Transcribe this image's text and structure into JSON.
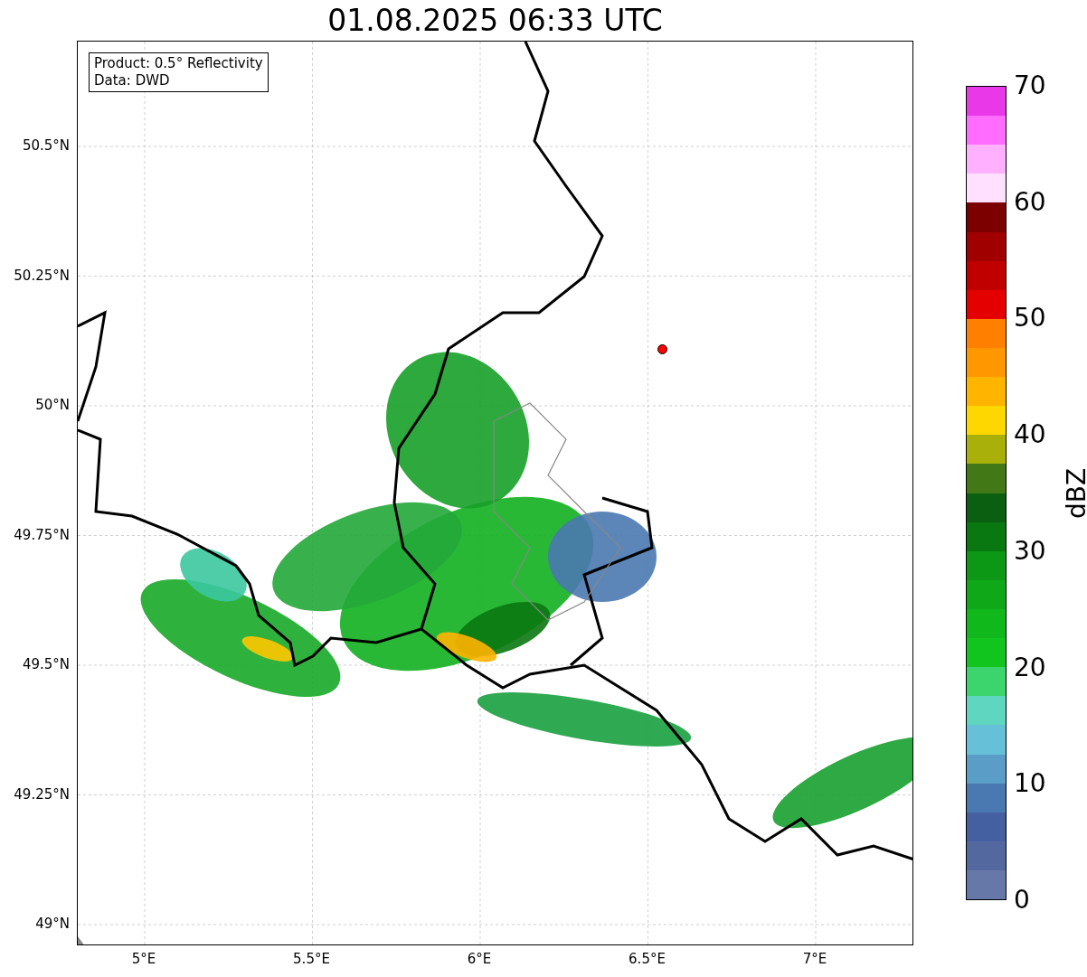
{
  "title": "01.08.2025 06:33 UTC",
  "info_box": {
    "lines": [
      "Product: 0.5° Reflectivity",
      "Data: DWD"
    ]
  },
  "map": {
    "x_ticks": [
      "5°E",
      "5.5°E",
      "6°E",
      "6.5°E",
      "7°E"
    ],
    "y_ticks": [
      "50.5°N",
      "50.25°N",
      "50°N",
      "49.75°N",
      "49.5°N",
      "49.25°N",
      "49°N"
    ]
  },
  "colorbar": {
    "label": "dBZ",
    "ticks": [
      "70",
      "60",
      "50",
      "40",
      "30",
      "20",
      "10",
      "0"
    ],
    "segments": [
      {
        "color": "#e838e8"
      },
      {
        "color": "#ff6cff"
      },
      {
        "color": "#ffb0ff"
      },
      {
        "color": "#ffe0ff"
      },
      {
        "color": "#7c0000"
      },
      {
        "color": "#a00000"
      },
      {
        "color": "#c00000"
      },
      {
        "color": "#e40000"
      },
      {
        "color": "#ff7f00"
      },
      {
        "color": "#ff9800"
      },
      {
        "color": "#ffb400"
      },
      {
        "color": "#ffd700"
      },
      {
        "color": "#aab00a"
      },
      {
        "color": "#437816"
      },
      {
        "color": "#0a6010"
      },
      {
        "color": "#0a7810"
      },
      {
        "color": "#0c9814"
      },
      {
        "color": "#0ea818"
      },
      {
        "color": "#10b81c"
      },
      {
        "color": "#12c41e"
      },
      {
        "color": "#3cd46c"
      },
      {
        "color": "#5fd6c0"
      },
      {
        "color": "#66c0d8"
      },
      {
        "color": "#5a9ec8"
      },
      {
        "color": "#4a78b0"
      },
      {
        "color": "#4560a0"
      },
      {
        "color": "#5468a0"
      },
      {
        "color": "#6678a8"
      }
    ]
  }
}
